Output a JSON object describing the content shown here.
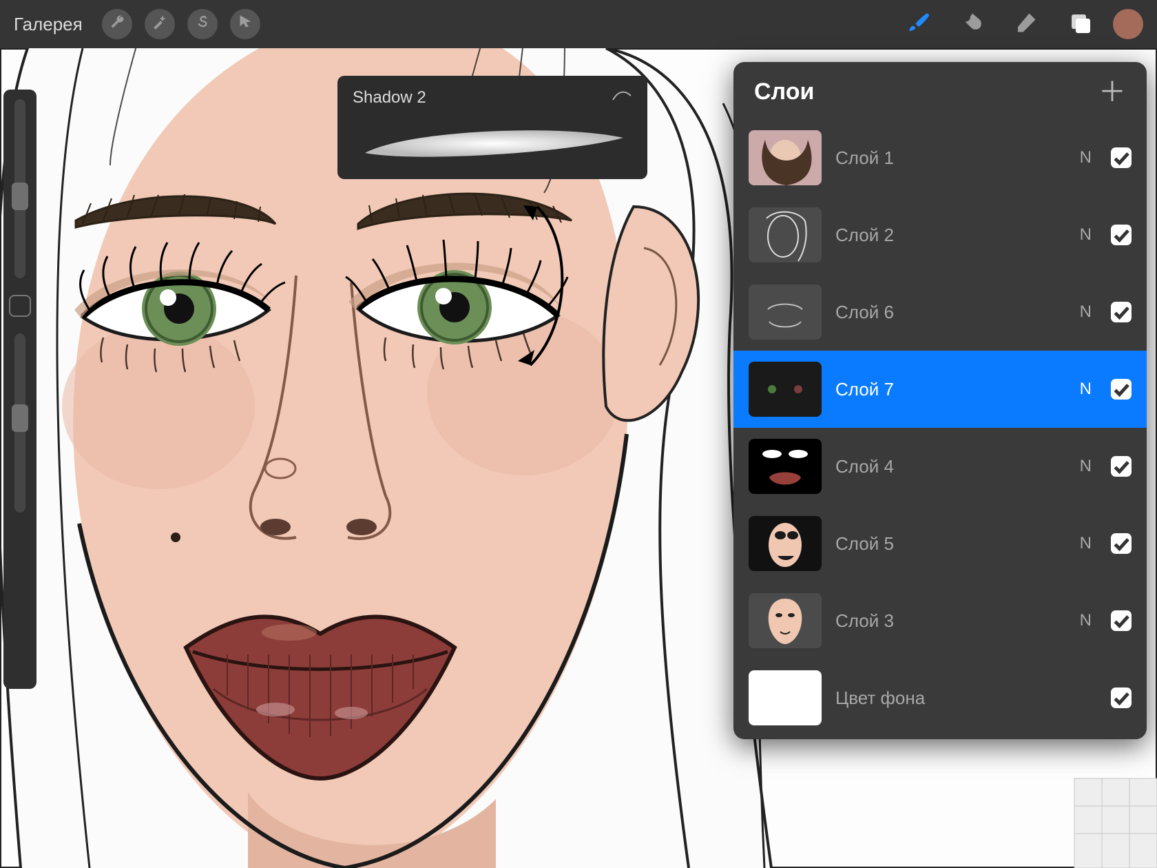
{
  "toolbar": {
    "gallery": "Галерея",
    "color_swatch": "#a46a5a"
  },
  "brush_tooltip": {
    "name": "Shadow 2"
  },
  "layers_panel": {
    "title": "Слои",
    "items": [
      {
        "name": "Слой 1",
        "blend": "N",
        "checked": true,
        "selected": false,
        "thumb": "photo"
      },
      {
        "name": "Слой 2",
        "blend": "N",
        "checked": true,
        "selected": false,
        "thumb": "sketch"
      },
      {
        "name": "Слой 6",
        "blend": "N",
        "checked": true,
        "selected": false,
        "thumb": "lips-outline"
      },
      {
        "name": "Слой 7",
        "blend": "N",
        "checked": true,
        "selected": true,
        "thumb": "eyes-dark"
      },
      {
        "name": "Слой 4",
        "blend": "N",
        "checked": true,
        "selected": false,
        "thumb": "lips-color"
      },
      {
        "name": "Слой 5",
        "blend": "N",
        "checked": true,
        "selected": false,
        "thumb": "shading"
      },
      {
        "name": "Слой 3",
        "blend": "N",
        "checked": true,
        "selected": false,
        "thumb": "skin"
      }
    ],
    "background": {
      "name": "Цвет фона",
      "checked": true
    }
  }
}
